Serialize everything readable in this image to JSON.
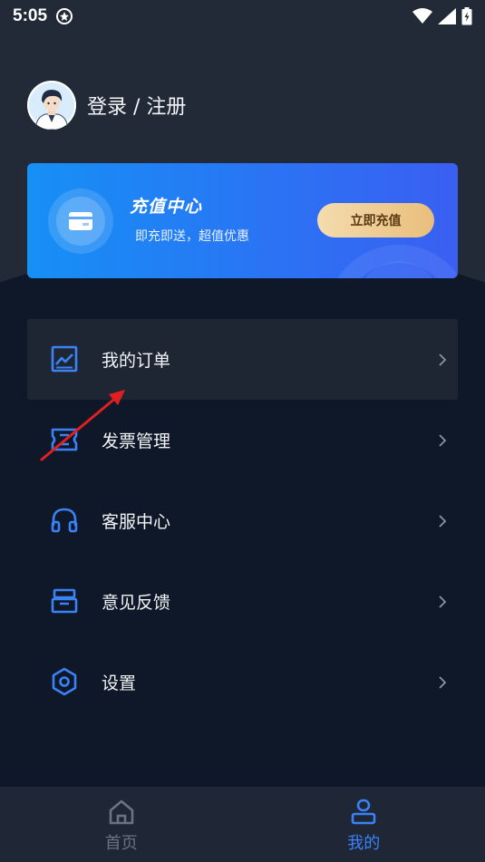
{
  "status_bar": {
    "time": "5:05"
  },
  "profile": {
    "label": "登录 / 注册"
  },
  "recharge": {
    "title": "充值中心",
    "subtitle": "即充即送，超值优惠",
    "button_label": "立即充值"
  },
  "menu": {
    "items": [
      {
        "label": "我的订单",
        "icon": "chart-icon"
      },
      {
        "label": "发票管理",
        "icon": "ticket-icon"
      },
      {
        "label": "客服中心",
        "icon": "headset-icon"
      },
      {
        "label": "意见反馈",
        "icon": "inbox-icon"
      },
      {
        "label": "设置",
        "icon": "hexagon-settings-icon"
      }
    ]
  },
  "tabbar": {
    "tabs": [
      {
        "label": "首页",
        "icon": "home-icon",
        "active": false
      },
      {
        "label": "我的",
        "icon": "user-icon",
        "active": true
      }
    ]
  },
  "colors": {
    "background": "#0f1828",
    "accent": "#3b82f6",
    "tab_inactive": "#6b7280",
    "annotation_arrow": "#e02020"
  }
}
